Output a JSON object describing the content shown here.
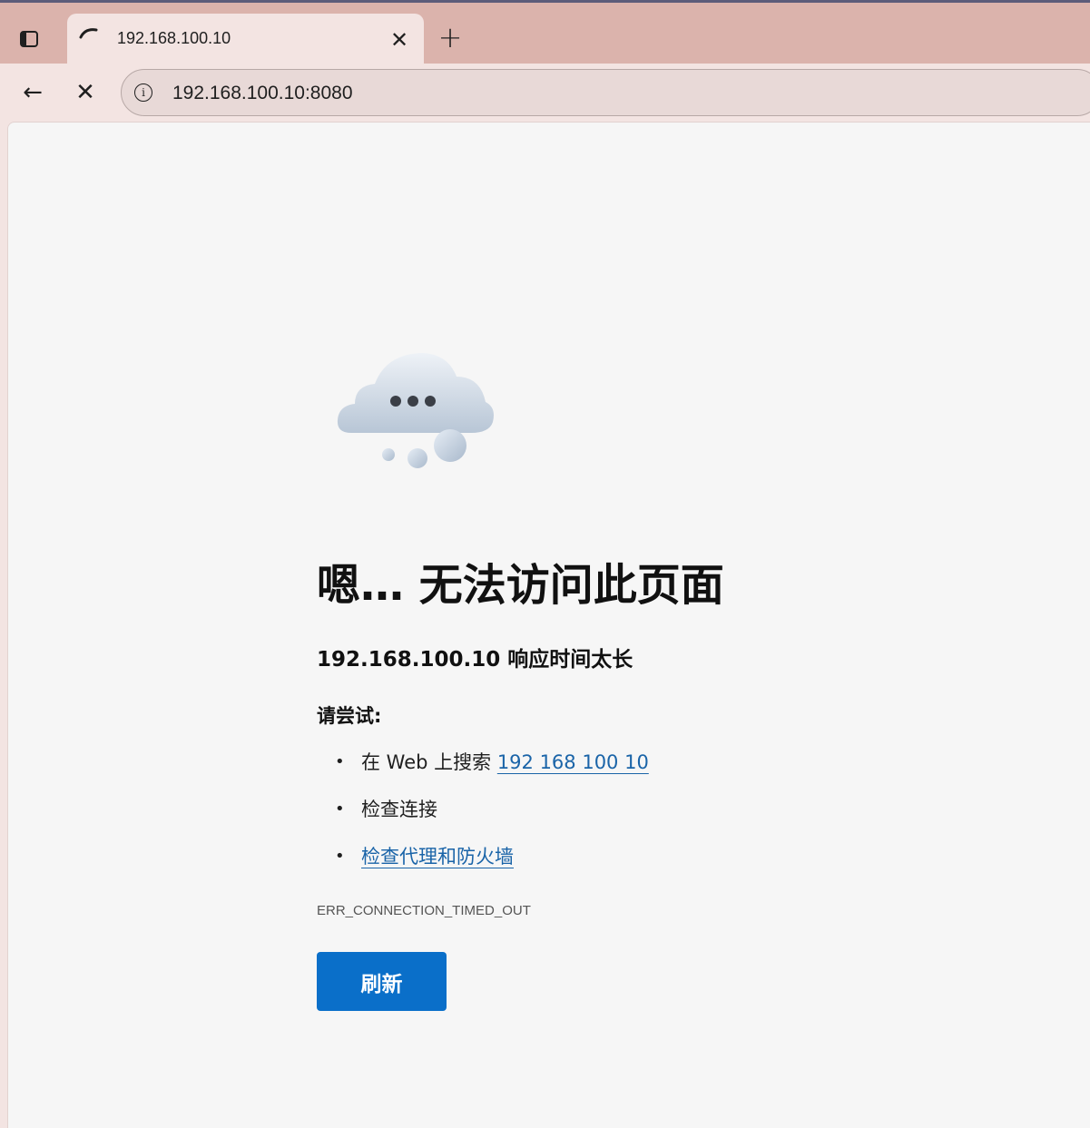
{
  "tab": {
    "title": "192.168.100.10",
    "close_glyph": "✕",
    "new_tab_glyph": "+"
  },
  "toolbar": {
    "back_glyph": "←",
    "stop_glyph": "✕",
    "info_glyph": "i",
    "url": "192.168.100.10:8080"
  },
  "error": {
    "title": "嗯… 无法访问此页面",
    "subtitle": "192.168.100.10 响应时间太长",
    "try_label": "请尝试:",
    "suggestions": {
      "search_prefix": "在 Web 上搜索 ",
      "search_link": "192 168 100 10",
      "check_connection": "检查连接",
      "check_proxy": "检查代理和防火墙"
    },
    "code": "ERR_CONNECTION_TIMED_OUT",
    "refresh_label": "刷新"
  },
  "colors": {
    "accent": "#0a6fc9",
    "link": "#1a64a8",
    "tabstrip": "#dbb3ac"
  },
  "icons": {
    "tab_actions": "tab-actions-icon",
    "favicon": "loading-spinner-icon",
    "illustration": "cloud-thinking-icon"
  }
}
